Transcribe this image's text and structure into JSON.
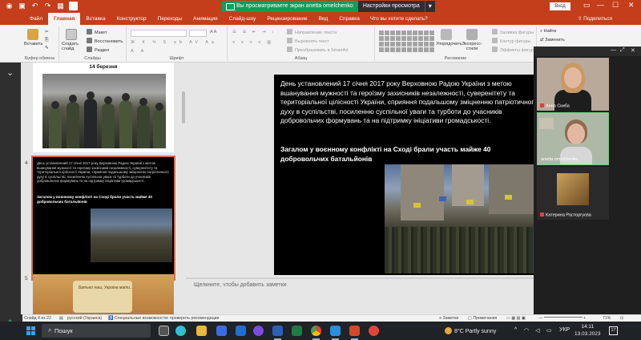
{
  "screen_share": {
    "banner_text": "Вы просматриваете экран anetta omelchenko",
    "settings_label": "Настройки просмотра",
    "more_label": "▾"
  },
  "titlebar": {
    "user_label": "Вход",
    "minimize": "—",
    "maximize": "☐",
    "close": "✕"
  },
  "menu": {
    "tabs": [
      "Файл",
      "Главная",
      "Вставка",
      "Конструктор",
      "Переходы",
      "Анимация",
      "Слайд-шоу",
      "Рецензирование",
      "Вид",
      "Справка"
    ],
    "active_index": 1,
    "tell_me": "Что вы хотите сделать?",
    "share": "Поделиться"
  },
  "ribbon": {
    "clipboard": {
      "label": "Буфер обмена",
      "paste": "Вставить"
    },
    "slides": {
      "label": "Слайды",
      "new_slide": "Создать слайд",
      "layout": "Макет",
      "reset": "Восстановить",
      "section": "Раздел"
    },
    "font": {
      "label": "Шрифт"
    },
    "paragraph": {
      "label": "Абзац",
      "text_direction": "Направление текста",
      "align_text": "Выровнять текст",
      "smartart": "Преобразовать в SmartArt"
    },
    "drawing": {
      "label": "Рисование",
      "arrange": "Упорядочить",
      "quick_styles": "Экспресс-стили",
      "shape_fill": "Заливка фигуры",
      "shape_outline": "Контур фигуры",
      "shape_effects": "Эффекты фигуры"
    },
    "editing": {
      "find": "Найти",
      "replace": "Заменить"
    }
  },
  "slides_panel": {
    "slide3": {
      "title": "14 березня"
    },
    "slide4": {
      "number": "4",
      "text": "День установлений 17 січня 2017 року Верховною Радою України з метою вшанування мужності та героїзму захисників незалежності, суверенітету та територіальної цілісності України, сприяння подальшому зміцненню патріотичного духу в суспільстві, посиленню суспільної уваги та турботи до учасників добровольчих формувань та на підтримку ініціативи громадськості.",
      "bold": "Загалом у воєнному конфлікті на Сході брали участь майже 40 добровольчих батальйонів"
    },
    "slide5": {
      "number": "5",
      "text": "Батько наш, Україна мати..."
    }
  },
  "main_slide": {
    "text": "День установлений 17 січня 2017 року Верховною Радою України з метою вшанування мужності та героїзму захисників незалежності, суверенітету та територіальної цілісності України, сприяння подальшому зміцненню патріотичного духу в суспільстві, посиленню суспільної уваги та турботи до учасників добровольчих формувань та на підтримку ініціативи громадськості.",
    "bold": "Загалом у воєнному конфлікті на Сході брали участь майже 40 добровольчих батальйонів"
  },
  "notes": {
    "placeholder": "Щелкните, чтобы добавить заметки"
  },
  "participants": [
    {
      "name": "Анна Скиба",
      "muted": true
    },
    {
      "name": "anetta omelchenko",
      "muted": false
    },
    {
      "name": "Катерина Расторгуєва",
      "muted": true
    }
  ],
  "statusbar": {
    "slide_info": "Слайд 4 из 22",
    "language": "русский (Украина)",
    "accessibility": "Специальные возможности: проверить рекомендации",
    "notes": "Заметки",
    "comments": "Примечания",
    "zoom": "71%"
  },
  "taskbar": {
    "search_label": "Пошук",
    "weather": "8°C  Partly sunny",
    "language": "УКР",
    "time": "14:11",
    "date": "13.03.2023",
    "notifications": "17"
  },
  "colors": {
    "accent": "#c43e1c",
    "share_green": "#0f9d58"
  }
}
